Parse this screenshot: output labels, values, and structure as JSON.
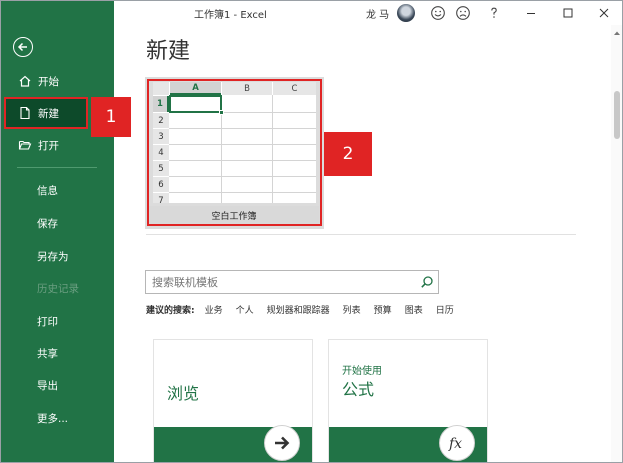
{
  "window": {
    "title": "工作簿1  -  Excel",
    "user": "龙 马"
  },
  "sidebar": {
    "items": [
      {
        "label": "开始"
      },
      {
        "label": "新建"
      },
      {
        "label": "打开"
      },
      {
        "label": "信息"
      },
      {
        "label": "保存"
      },
      {
        "label": "另存为"
      },
      {
        "label": "历史记录"
      },
      {
        "label": "打印"
      },
      {
        "label": "共享"
      },
      {
        "label": "导出"
      },
      {
        "label": "更多..."
      }
    ]
  },
  "callouts": {
    "one": "1",
    "two": "2"
  },
  "main": {
    "page_title": "新建",
    "blank_workbook": {
      "label": "空白工作簿",
      "columns": [
        "A",
        "B",
        "C"
      ],
      "rows": [
        "1",
        "2",
        "3",
        "4",
        "5",
        "6",
        "7"
      ]
    },
    "search": {
      "placeholder": "搜索联机模板"
    },
    "suggested": {
      "label": "建议的搜索:",
      "items": [
        "业务",
        "个人",
        "规划器和跟踪器",
        "列表",
        "预算",
        "图表",
        "日历"
      ]
    },
    "cards": [
      {
        "title": "浏览"
      },
      {
        "subtitle": "开始使用",
        "title": "公式"
      }
    ]
  },
  "colors": {
    "accent": "#217346",
    "callout": "#e02424"
  }
}
